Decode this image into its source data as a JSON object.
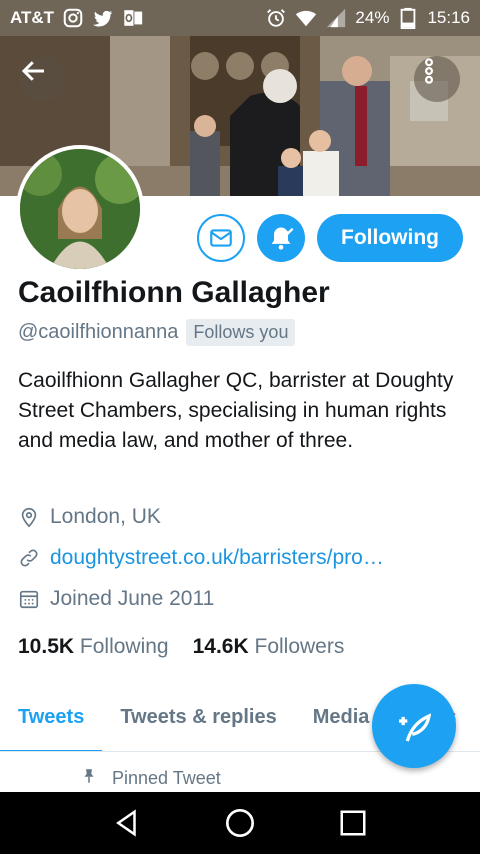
{
  "status_bar": {
    "carrier": "AT&T",
    "battery": "24%",
    "time": "15:16",
    "icons": [
      "instagram-icon",
      "twitter-icon",
      "outlook-icon",
      "alarm-icon",
      "wifi-icon",
      "signal-icon",
      "battery-icon"
    ]
  },
  "profile": {
    "name": "Caoilfhionn Gallagher",
    "handle": "@caoilfhionnanna",
    "follows_you": "Follows you",
    "bio": "Caoilfhionn Gallagher QC, barrister at Doughty Street Chambers, specialising in human rights and media law, and mother of three.",
    "location": "London, UK",
    "website": "doughtystreet.co.uk/barristers/pro…",
    "joined": "Joined June 2011",
    "following_count": "10.5K",
    "following_label": "Following",
    "followers_count": "14.6K",
    "followers_label": "Followers"
  },
  "actions": {
    "following_button": "Following"
  },
  "tabs": [
    {
      "label": "Tweets",
      "active": true
    },
    {
      "label": "Tweets & replies",
      "active": false
    },
    {
      "label": "Media",
      "active": false
    },
    {
      "label": "Likes",
      "active": false
    }
  ],
  "pinned": {
    "label": "Pinned Tweet"
  },
  "colors": {
    "accent": "#1da1f2",
    "link": "#1b95e0",
    "secondary_text": "#657786",
    "status_bar": "#6f6658"
  }
}
